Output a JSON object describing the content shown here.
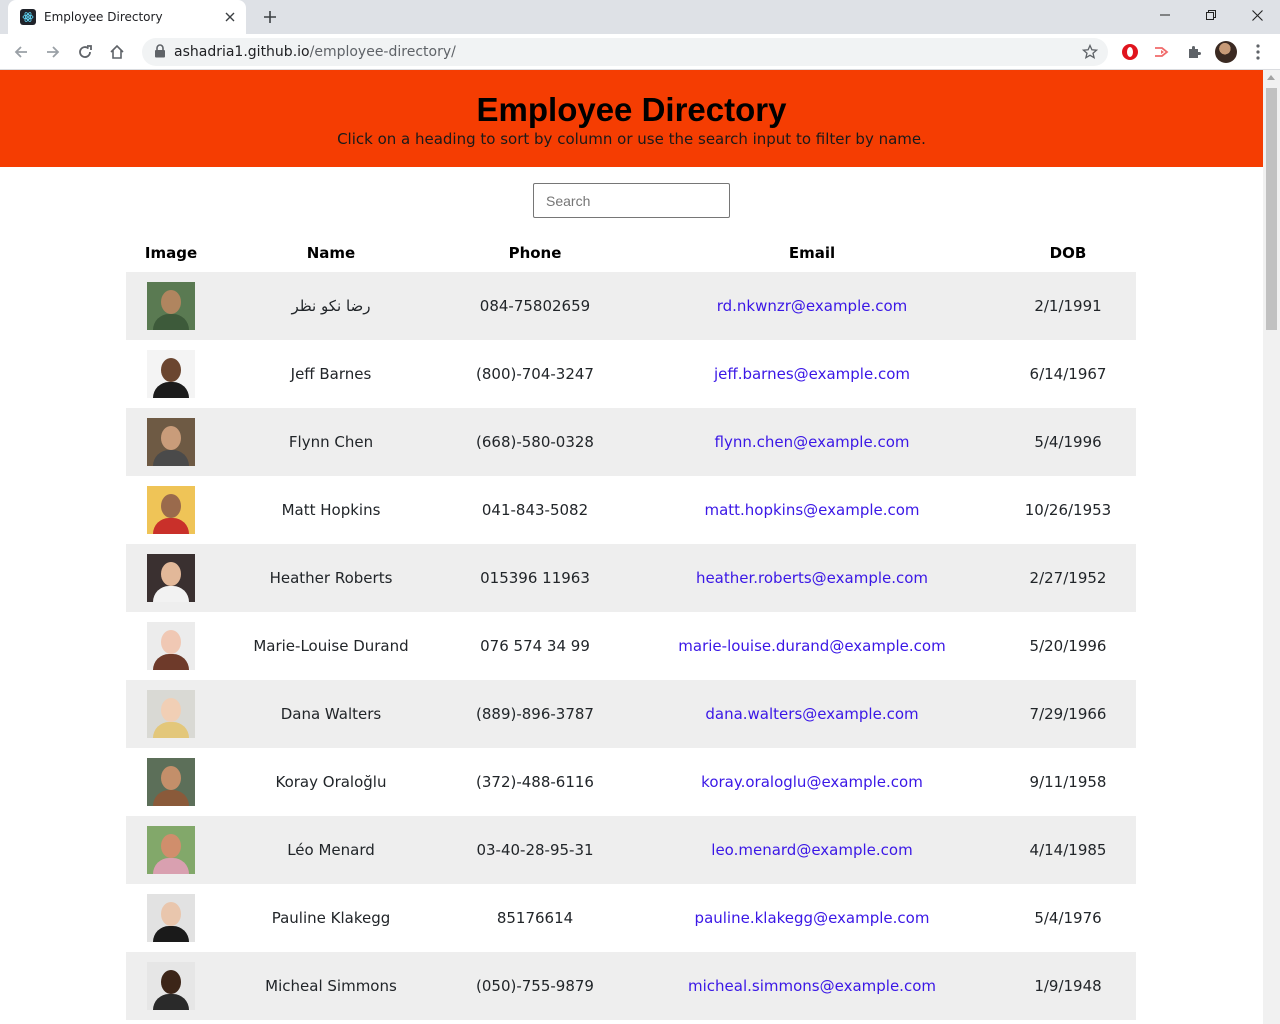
{
  "browser": {
    "tab_title": "Employee Directory",
    "url_host": "ashadria1.github.io",
    "url_path": "/employee-directory/"
  },
  "page": {
    "title": "Employee Directory",
    "subtitle": "Click on a heading to sort by column or use the search input to filter by name.",
    "search_placeholder": "Search",
    "header_color": "#f53d02"
  },
  "table": {
    "headers": {
      "image": "Image",
      "name": "Name",
      "phone": "Phone",
      "email": "Email",
      "dob": "DOB"
    },
    "rows": [
      {
        "name": "رضا نکو نظر",
        "phone": "084-75802659",
        "email": "rd.nkwnzr@example.com",
        "dob": "2/1/1991",
        "photo": {
          "bg": "#5a7a52",
          "skin": "#b0855f",
          "shirt": "#3d5a3a"
        }
      },
      {
        "name": "Jeff Barnes",
        "phone": "(800)-704-3247",
        "email": "jeff.barnes@example.com",
        "dob": "6/14/1967",
        "photo": {
          "bg": "#f4f4f4",
          "skin": "#6b4630",
          "shirt": "#1c1c1c"
        }
      },
      {
        "name": "Flynn Chen",
        "phone": "(668)-580-0328",
        "email": "flynn.chen@example.com",
        "dob": "5/4/1996",
        "photo": {
          "bg": "#6e5a44",
          "skin": "#c99c7a",
          "shirt": "#4a4a4a"
        }
      },
      {
        "name": "Matt Hopkins",
        "phone": "041-843-5082",
        "email": "matt.hopkins@example.com",
        "dob": "10/26/1953",
        "photo": {
          "bg": "#efc457",
          "skin": "#9a6a4c",
          "shirt": "#c9302a"
        }
      },
      {
        "name": "Heather Roberts",
        "phone": "015396 11963",
        "email": "heather.roberts@example.com",
        "dob": "2/27/1952",
        "photo": {
          "bg": "#3a3030",
          "skin": "#e2b899",
          "shirt": "#f2f2f2"
        }
      },
      {
        "name": "Marie-Louise Durand",
        "phone": "076 574 34 99",
        "email": "marie-louise.durand@example.com",
        "dob": "5/20/1996",
        "photo": {
          "bg": "#ececec",
          "skin": "#f0c8b4",
          "shirt": "#6e3a2a"
        }
      },
      {
        "name": "Dana Walters",
        "phone": "(889)-896-3787",
        "email": "dana.walters@example.com",
        "dob": "7/29/1966",
        "photo": {
          "bg": "#d9d9d4",
          "skin": "#f1cfb5",
          "shirt": "#e3c77a"
        }
      },
      {
        "name": "Koray Oraloğlu",
        "phone": "(372)-488-6116",
        "email": "koray.oraloglu@example.com",
        "dob": "9/11/1958",
        "photo": {
          "bg": "#5c6f59",
          "skin": "#c38f6a",
          "shirt": "#8a5a3a"
        }
      },
      {
        "name": "Léo Menard",
        "phone": "03-40-28-95-31",
        "email": "leo.menard@example.com",
        "dob": "4/14/1985",
        "photo": {
          "bg": "#82a86a",
          "skin": "#d08e6c",
          "shirt": "#d9a0b0"
        }
      },
      {
        "name": "Pauline Klakegg",
        "phone": "85176614",
        "email": "pauline.klakegg@example.com",
        "dob": "5/4/1976",
        "photo": {
          "bg": "#e2e2e2",
          "skin": "#e9c6ad",
          "shirt": "#1a1a1a"
        }
      },
      {
        "name": "Micheal Simmons",
        "phone": "(050)-755-9879",
        "email": "micheal.simmons@example.com",
        "dob": "1/9/1948",
        "photo": {
          "bg": "#e6e6e6",
          "skin": "#3c2518",
          "shirt": "#2a2a2a"
        }
      }
    ]
  }
}
